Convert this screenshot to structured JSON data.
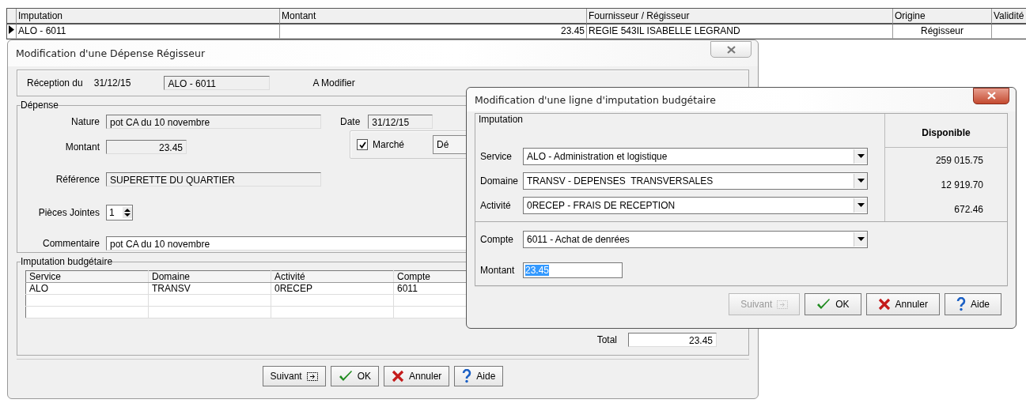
{
  "grid": {
    "columns": [
      "Imputation",
      "Montant",
      "Fournisseur / Régisseur",
      "Origine",
      "Validité"
    ],
    "rows": [
      {
        "selected": true,
        "imputation": "ALO - 6011",
        "montant": "23.45",
        "fournisseur": "REGIE 543IL ISABELLE LEGRAND",
        "origine": "Régisseur"
      }
    ]
  },
  "expense_dialog": {
    "title": "Modification d'une Dépense Régisseur",
    "reception_label": "Réception du",
    "reception_date": "31/12/15",
    "imputation_value": "ALO - 6011",
    "status": "A Modifier",
    "depense_group": "Dépense",
    "nature": {
      "label": "Nature",
      "value": "pot CA du 10 novembre"
    },
    "date": {
      "label": "Date",
      "value": "31/12/15"
    },
    "montant": {
      "label": "Montant",
      "value": "23.45"
    },
    "marche": {
      "label": "Marché",
      "checked": true
    },
    "partial_button": "Dé",
    "reference": {
      "label": "Référence",
      "value": "SUPERETTE DU QUARTIER"
    },
    "pieces": {
      "label": "Pièces Jointes",
      "value": "1"
    },
    "commentaire": {
      "label": "Commentaire",
      "value": "pot CA du 10 novembre"
    },
    "imputation_group": "Imputation budgétaire",
    "table": {
      "columns": [
        "Service",
        "Domaine",
        "Activité",
        "Compte"
      ],
      "rows": [
        {
          "cells": [
            "ALO",
            "TRANSV",
            "0RECEP",
            "6011"
          ]
        }
      ]
    },
    "total": {
      "label": "Total",
      "value": "23.45"
    },
    "buttons": [
      {
        "kind": "next",
        "label": "Suivant",
        "disabled": false
      },
      {
        "kind": "ok",
        "label": "OK",
        "disabled": false
      },
      {
        "kind": "cancel",
        "label": "Annuler",
        "disabled": false
      },
      {
        "kind": "help",
        "label": "Aide",
        "disabled": false
      }
    ]
  },
  "line_dialog": {
    "title": "Modification d'une ligne d'imputation budgétaire",
    "group": "Imputation",
    "available_header": "Disponible",
    "lines": [
      {
        "label": "Service",
        "value": "ALO - Administration et logistique",
        "available": "259 015.75"
      },
      {
        "label": "Domaine",
        "value": "TRANSV - DEPENSES  TRANSVERSALES",
        "available": "12 919.70"
      },
      {
        "label": "Activité",
        "value": "0RECEP - FRAIS DE RECEPTION",
        "available": "672.46"
      }
    ],
    "compte": {
      "label": "Compte",
      "value": "6011 - Achat de denrées"
    },
    "montant": {
      "label": "Montant",
      "value": "23.45"
    },
    "buttons": [
      {
        "kind": "next",
        "label": "Suivant",
        "disabled": true
      },
      {
        "kind": "ok",
        "label": "OK",
        "disabled": false
      },
      {
        "kind": "cancel",
        "label": "Annuler",
        "disabled": false
      },
      {
        "kind": "help",
        "label": "Aide",
        "disabled": false
      }
    ]
  }
}
